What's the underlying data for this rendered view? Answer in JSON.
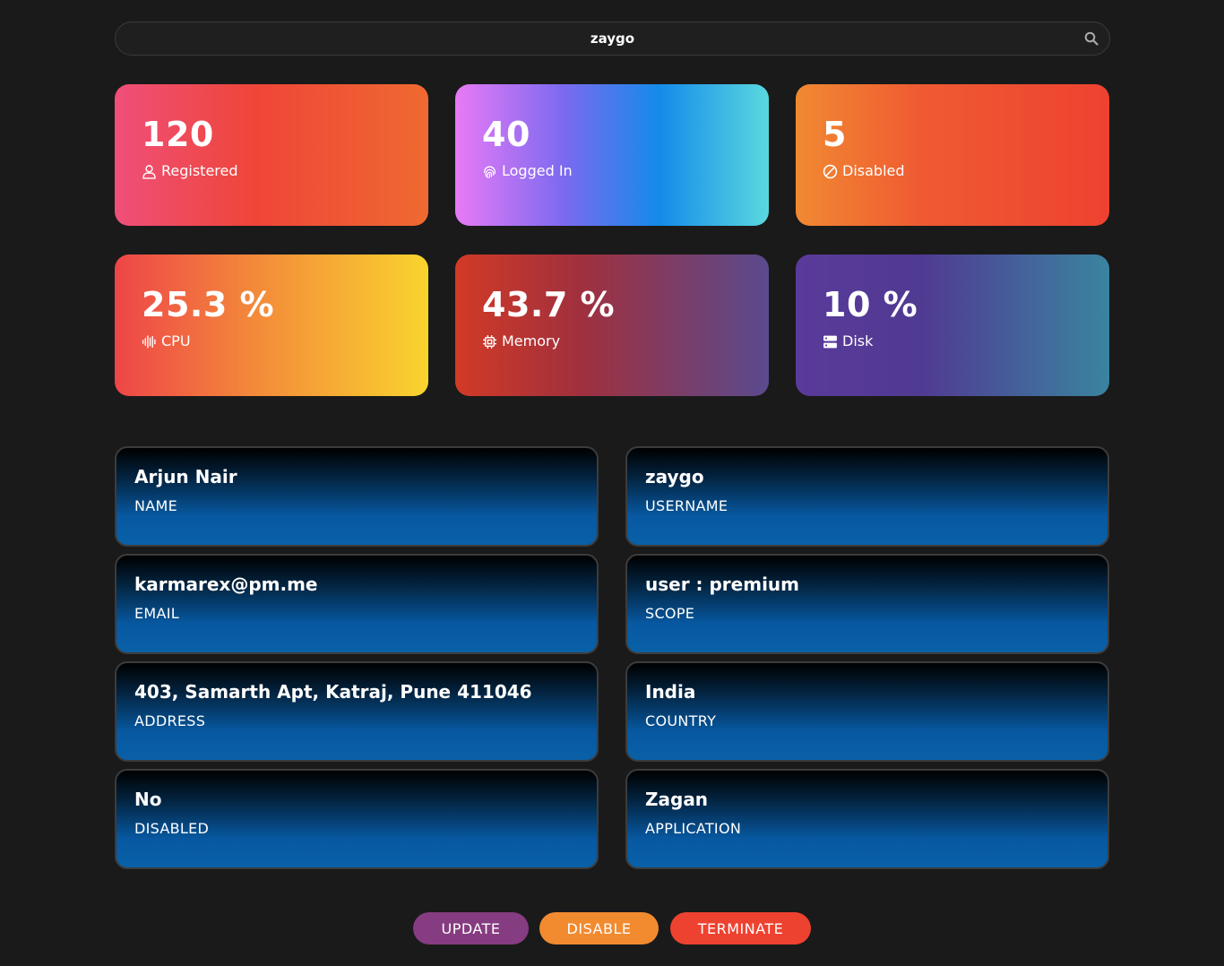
{
  "search": {
    "value": "zaygo",
    "icon": "search-icon"
  },
  "stats": [
    {
      "value": "120",
      "label": "Registered",
      "icon": "user-icon"
    },
    {
      "value": "40",
      "label": "Logged In",
      "icon": "fingerprint-icon"
    },
    {
      "value": "5",
      "label": "Disabled",
      "icon": "ban-icon"
    },
    {
      "value": "25.3 %",
      "label": "CPU",
      "icon": "waveform-icon"
    },
    {
      "value": "43.7 %",
      "label": "Memory",
      "icon": "chip-icon"
    },
    {
      "value": "10 %",
      "label": "Disk",
      "icon": "server-icon"
    }
  ],
  "details": {
    "name": {
      "value": "Arjun Nair",
      "label": "NAME"
    },
    "username": {
      "value": "zaygo",
      "label": "USERNAME"
    },
    "email": {
      "value": "karmarex@pm.me",
      "label": "EMAIL"
    },
    "scope": {
      "value": "user : premium",
      "label": "SCOPE"
    },
    "address": {
      "value": "403, Samarth Apt, Katraj, Pune 411046",
      "label": "ADDRESS"
    },
    "country": {
      "value": "India",
      "label": "COUNTRY"
    },
    "disabled": {
      "value": "No",
      "label": "DISABLED"
    },
    "application": {
      "value": "Zagan",
      "label": "APPLICATION"
    }
  },
  "actions": {
    "update_label": "UPDATE",
    "disable_label": "DISABLE",
    "terminate_label": "TERMINATE"
  },
  "colors": {
    "background": "#1a1a1a",
    "update_button": "#853c80",
    "disable_button": "#f28a30",
    "terminate_button": "#ee4230"
  }
}
